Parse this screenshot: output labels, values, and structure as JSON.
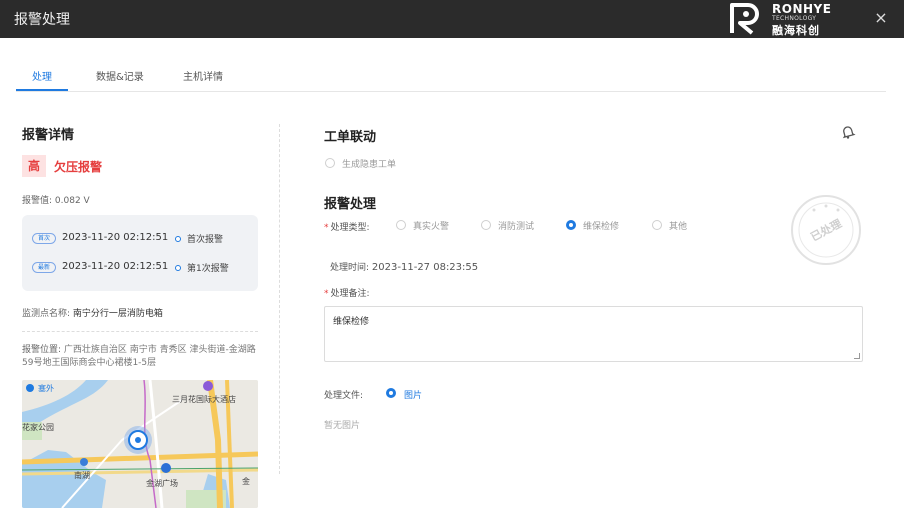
{
  "window": {
    "title": "报警处理",
    "close_icon": "close-icon"
  },
  "logo": {
    "en": "RONHYE",
    "sub": "TECHNOLOGY",
    "cn": "融海科创"
  },
  "tabs": [
    {
      "label": "处理",
      "active": true
    },
    {
      "label": "数据&记录",
      "active": false
    },
    {
      "label": "主机详情",
      "active": false
    }
  ],
  "detail": {
    "title": "报警详情",
    "level": "高",
    "alarm_type": "欠压报警",
    "alarm_value_label": "报警值:",
    "alarm_value": "0.082 V",
    "timeline": [
      {
        "tag": "首次",
        "time": "2023-11-20 02:12:51",
        "label": "首次报警"
      },
      {
        "tag": "最新",
        "time": "2023-11-20 02:12:51",
        "label": "第1次报警"
      }
    ],
    "monitor_label": "监测点名称:",
    "monitor_value": "南宁分行一层消防电箱",
    "location_label": "报警位置:",
    "location_value": "广西壮族自治区 南宁市 青秀区 津头街道-金湖路59号地王国际商会中心裙楼1-5层"
  },
  "map": {
    "labels": [
      "塞外",
      "三月花国际大酒店",
      "花家公园",
      "南湖",
      "金湖广场",
      "金"
    ]
  },
  "work_order": {
    "title": "工单联动",
    "option": "生成隐患工单"
  },
  "handling": {
    "title": "报警处理",
    "type_label": "处理类型:",
    "types": [
      {
        "label": "真实火警",
        "checked": false
      },
      {
        "label": "消防测试",
        "checked": false
      },
      {
        "label": "维保检修",
        "checked": true
      },
      {
        "label": "其他",
        "checked": false
      }
    ],
    "time_label": "处理时间:",
    "time_value": "2023-11-27 08:23:55",
    "remark_label": "处理备注:",
    "remark_value": "维保检修",
    "file_label": "处理文件:",
    "file_option": "图片",
    "no_image": "暂无图片",
    "stamp": "已处理"
  },
  "colors": {
    "accent": "#1f7ae0",
    "danger": "#e53e3e",
    "titlebar": "#2b2b2b"
  }
}
